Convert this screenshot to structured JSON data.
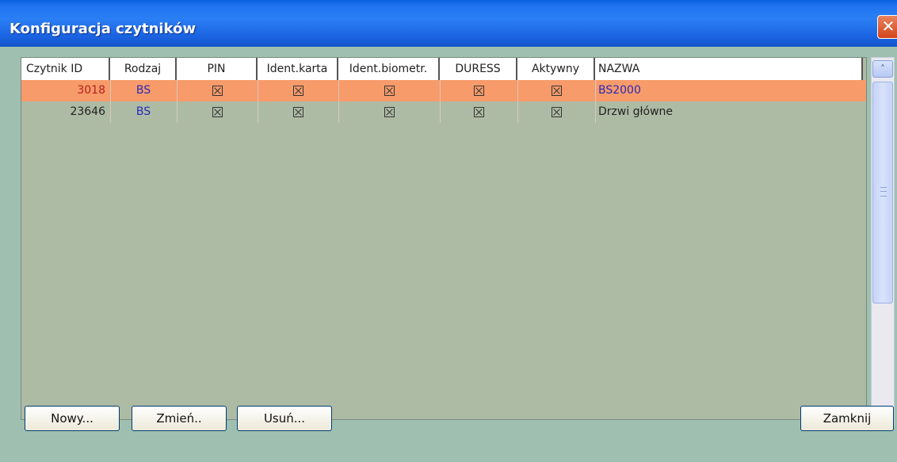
{
  "window": {
    "title": "Konfiguracja czytników",
    "close_glyph": "✕"
  },
  "table": {
    "columns": [
      "Czytnik ID",
      "Rodzaj",
      "PIN",
      "Ident.karta",
      "Ident.biometr.",
      "DURESS",
      "Aktywny",
      "NAZWA"
    ],
    "rows": [
      {
        "id": "3018",
        "rodzaj": "BS",
        "pin": true,
        "karta": true,
        "biometr": true,
        "duress": true,
        "aktywny": true,
        "nazwa": "BS2000",
        "selected": true
      },
      {
        "id": "23646",
        "rodzaj": "BS",
        "pin": true,
        "karta": true,
        "biometr": true,
        "duress": true,
        "aktywny": true,
        "nazwa": "Drzwi główne",
        "selected": false
      }
    ]
  },
  "scrollbar": {
    "up_glyph": "˄",
    "down_glyph": "˅"
  },
  "buttons": {
    "new": "Nowy...",
    "edit": "Zmień..",
    "delete": "Usuń...",
    "close": "Zamknij"
  },
  "colors": {
    "title_bar": "#2b7ff5",
    "selected_row": "#f79b6a",
    "grid_bg": "#adbba5",
    "client_bg": "#9fc0b0"
  },
  "icons": {
    "checkbox": "checked-checkbox-icon"
  }
}
